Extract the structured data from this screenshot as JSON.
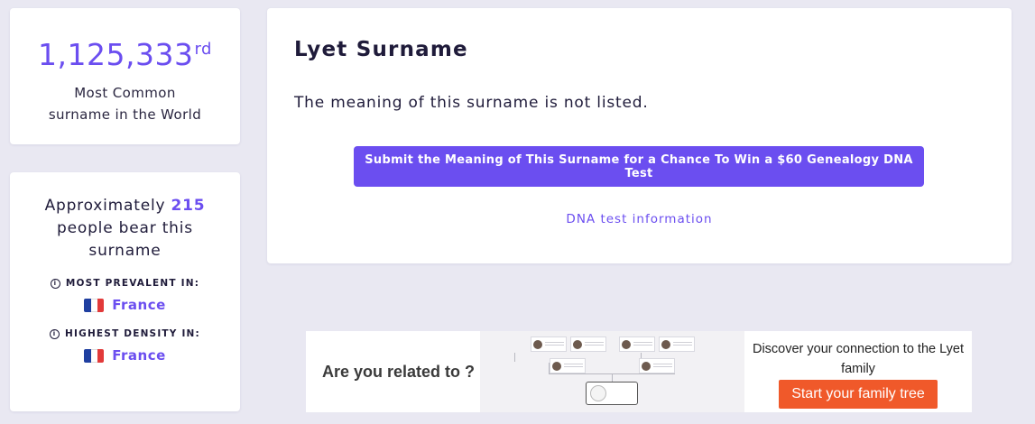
{
  "rank": {
    "number": "1,125,333",
    "suffix": "rd",
    "line1": "Most Common",
    "line2": "surname in the World"
  },
  "people": {
    "pre": "Approximately ",
    "count": "215",
    "post": " people bear this surname",
    "prevalent_label": "MOST PREVALENT IN:",
    "prevalent_country": "France",
    "density_label": "HIGHEST DENSITY IN:",
    "density_country": "France",
    "info_icon": "info-circle-icon",
    "flag_icon": "france-flag-icon"
  },
  "main": {
    "title": "Lyet Surname",
    "meaning": "The meaning of this surname is not listed.",
    "submit_label": "Submit the Meaning of This Surname for a Chance To Win a $60 Genealogy DNA Test",
    "dna_link": "DNA test information"
  },
  "ad": {
    "left_text": "Are you related to ?",
    "right_text": "Discover your connection to the Lyet family",
    "button_label": "Start your family tree",
    "button_color": "#f0592a"
  },
  "colors": {
    "accent": "#6b4ef0",
    "background": "#e9e8f2"
  }
}
